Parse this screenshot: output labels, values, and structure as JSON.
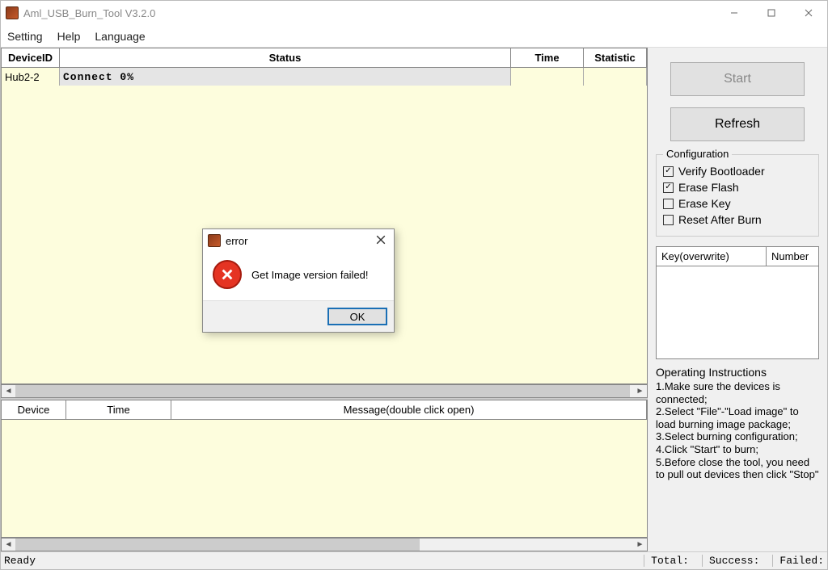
{
  "window": {
    "title": "Aml_USB_Burn_Tool V3.2.0"
  },
  "menu": {
    "setting": "Setting",
    "help": "Help",
    "language": "Language"
  },
  "device_table": {
    "headers": {
      "device_id": "DeviceID",
      "status": "Status",
      "time": "Time",
      "statistic": "Statistic"
    },
    "rows": [
      {
        "device_id": "Hub2-2",
        "status": "Connect 0%",
        "time": "",
        "statistic": ""
      }
    ]
  },
  "message_table": {
    "headers": {
      "device": "Device",
      "time": "Time",
      "message": "Message(double click open)"
    }
  },
  "side": {
    "start": "Start",
    "refresh": "Refresh",
    "config_title": "Configuration",
    "checkboxes": {
      "verify_bootloader": {
        "label": "Verify Bootloader",
        "checked": true
      },
      "erase_flash": {
        "label": "Erase Flash",
        "checked": true
      },
      "erase_key": {
        "label": "Erase Key",
        "checked": false
      },
      "reset_after_burn": {
        "label": "Reset After Burn",
        "checked": false
      }
    },
    "key_table": {
      "col1": "Key(overwrite)",
      "col2": "Number"
    },
    "instructions": {
      "title": "Operating Instructions",
      "l1": "1.Make sure the devices is connected;",
      "l2": "2.Select \"File\"-\"Load image\" to load burning image package;",
      "l3": "3.Select burning configuration;",
      "l4": "4.Click \"Start\" to burn;",
      "l5": "5.Before close the tool, you need to pull out devices then click \"Stop\""
    }
  },
  "status_bar": {
    "left": "Ready",
    "total": "Total:",
    "success": "Success:",
    "failed": "Failed:"
  },
  "dialog": {
    "title": "error",
    "message": "Get Image version failed!",
    "ok": "OK"
  }
}
